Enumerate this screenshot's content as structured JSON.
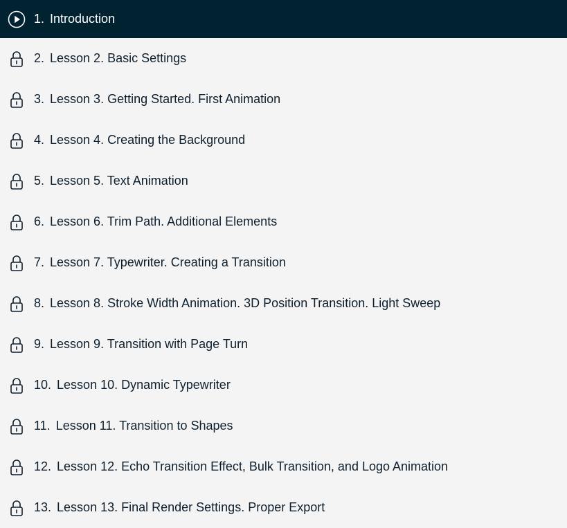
{
  "lessons": [
    {
      "number": "1.",
      "title": "Introduction",
      "icon": "play-circle-icon",
      "active": true
    },
    {
      "number": "2.",
      "title": "Lesson 2. Basic Settings",
      "icon": "lock-icon"
    },
    {
      "number": "3.",
      "title": "Lesson 3. Getting Started. First Animation",
      "icon": "lock-icon"
    },
    {
      "number": "4.",
      "title": "Lesson 4. Creating the Background",
      "icon": "lock-icon"
    },
    {
      "number": "5.",
      "title": "Lesson 5. Text Animation",
      "icon": "lock-icon"
    },
    {
      "number": "6.",
      "title": "Lesson 6. Trim Path. Additional Elements",
      "icon": "lock-icon"
    },
    {
      "number": "7.",
      "title": "Lesson 7. Typewriter. Creating a Transition",
      "icon": "lock-icon"
    },
    {
      "number": "8.",
      "title": "Lesson 8. Stroke Width Animation. 3D Position Transition. Light Sweep",
      "icon": "lock-icon"
    },
    {
      "number": "9.",
      "title": "Lesson 9. Transition with Page Turn",
      "icon": "lock-icon"
    },
    {
      "number": "10.",
      "title": "Lesson 10. Dynamic Typewriter",
      "icon": "lock-icon"
    },
    {
      "number": "11.",
      "title": "Lesson 11. Transition to Shapes",
      "icon": "lock-icon"
    },
    {
      "number": "12.",
      "title": "Lesson 12. Echo Transition Effect, Bulk Transition, and Logo Animation",
      "icon": "lock-icon"
    },
    {
      "number": "13.",
      "title": "Lesson 13. Final Render Settings. Proper Export",
      "icon": "lock-icon"
    }
  ],
  "colors": {
    "active_bg": "#012231",
    "active_text": "#ffffff",
    "list_bg": "#f4f4f4",
    "text": "#0e1f2e"
  }
}
